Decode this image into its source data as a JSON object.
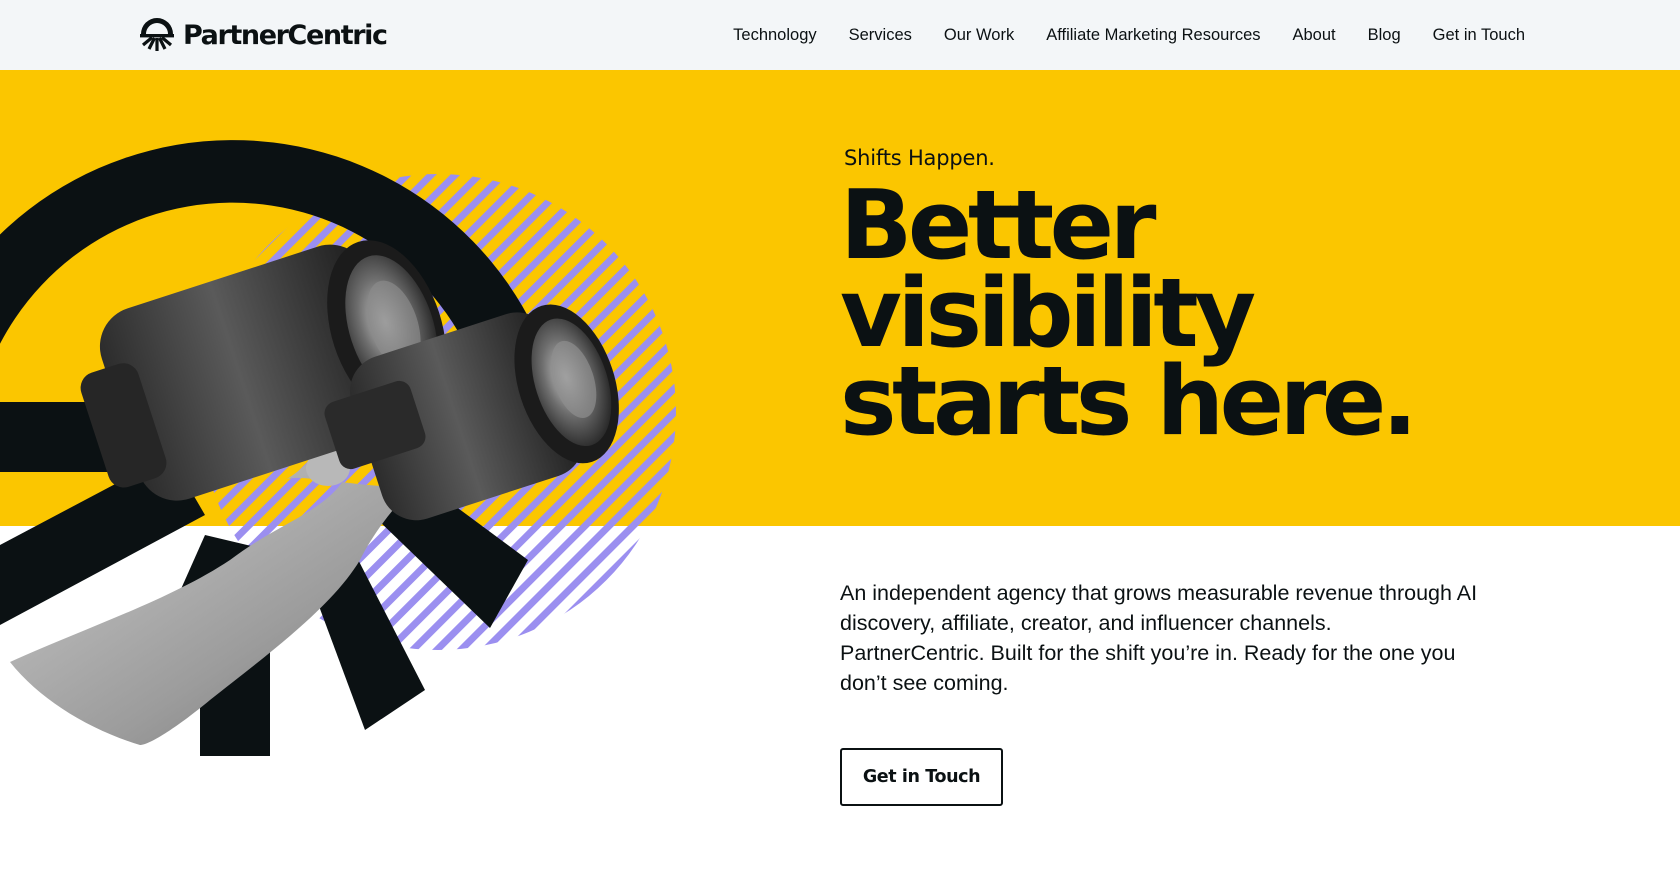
{
  "brand": {
    "name": "PartnerCentric",
    "logo_icon": "sunrise-logo-icon"
  },
  "nav": {
    "items": [
      {
        "label": "Technology"
      },
      {
        "label": "Services"
      },
      {
        "label": "Our Work"
      },
      {
        "label": "Affiliate Marketing Resources"
      },
      {
        "label": "About"
      },
      {
        "label": "Blog"
      },
      {
        "label": "Get in Touch"
      }
    ]
  },
  "hero": {
    "eyebrow": "Shifts Happen.",
    "headline_lines": [
      "Better",
      "visibility",
      "starts here."
    ],
    "intro_lines": [
      "An independent agency that grows measurable revenue through AI",
      "discovery, affiliate, creator, and influencer channels.",
      "PartnerCentric. Built for the shift you’re in. Ready for the one you",
      "don’t see coming."
    ],
    "cta_label": "Get in Touch",
    "illustration": "hand-holding-binoculars-illustration"
  },
  "colors": {
    "accent_yellow": "#fbc600",
    "ink": "#0b1113",
    "stripe_purple": "#9b8ff0",
    "header_bg": "#f3f6f8"
  }
}
